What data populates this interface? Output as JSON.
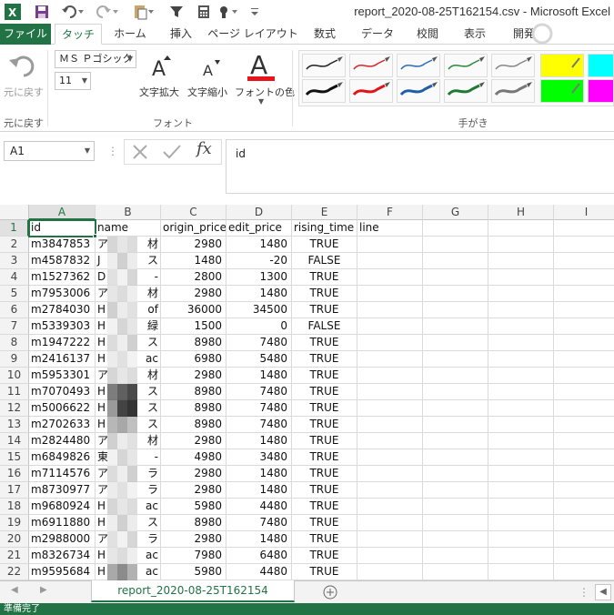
{
  "window": {
    "title": "report_2020-08-25T162154.csv - Microsoft Excel"
  },
  "ribbon": {
    "tabs": [
      {
        "label": "ファイル"
      },
      {
        "label": "タッチ"
      },
      {
        "label": "ホーム"
      },
      {
        "label": "挿入"
      },
      {
        "label": "ページ レイアウト"
      },
      {
        "label": "数式"
      },
      {
        "label": "データ"
      },
      {
        "label": "校閲"
      },
      {
        "label": "表示"
      },
      {
        "label": "開発"
      }
    ],
    "undo_label": "元に戻す",
    "undo_group_label": "元に戻す",
    "font_name": "ＭＳ Ｐゴシック",
    "font_size": "11",
    "grow_font_label": "文字拡大",
    "shrink_font_label": "文字縮小",
    "font_color_label": "フォントの色",
    "font_group_label": "フォント",
    "handwriting_group_label": "手がき",
    "accent_color": "#217346"
  },
  "formula_bar": {
    "name_box": "A1",
    "fx_label": "fx",
    "formula": "id"
  },
  "sheet": {
    "columns": [
      "A",
      "B",
      "C",
      "D",
      "E",
      "F",
      "G",
      "H",
      "I"
    ],
    "row_numbers": [
      "1",
      "2",
      "3",
      "4",
      "5",
      "6",
      "7",
      "8",
      "9",
      "10",
      "11",
      "12",
      "13",
      "14",
      "15",
      "16",
      "17",
      "18",
      "19",
      "20",
      "21",
      "22"
    ],
    "header": {
      "a": "id",
      "b": "name",
      "c": "origin_price",
      "d": "edit_price",
      "e": "rising_time",
      "f": "line"
    },
    "rows": [
      {
        "a": "m3847853",
        "b": "ア",
        "b2": "材",
        "c": "2980",
        "d": "1480",
        "e": "TRUE"
      },
      {
        "a": "m4587832",
        "b": "J",
        "b2": "ス",
        "c": "1480",
        "d": "-20",
        "e": "FALSE"
      },
      {
        "a": "m1527362",
        "b": "D",
        "b2": "-",
        "c": "2800",
        "d": "1300",
        "e": "TRUE"
      },
      {
        "a": "m7953006",
        "b": "ア",
        "b2": "材",
        "c": "2980",
        "d": "1480",
        "e": "TRUE"
      },
      {
        "a": "m2784030",
        "b": "H",
        "b2": "of",
        "c": "36000",
        "d": "34500",
        "e": "TRUE"
      },
      {
        "a": "m5339303",
        "b": "H",
        "b2": "緑",
        "c": "1500",
        "d": "0",
        "e": "FALSE"
      },
      {
        "a": "m1947222",
        "b": "H",
        "b2": "ス",
        "c": "8980",
        "d": "7480",
        "e": "TRUE"
      },
      {
        "a": "m2416137",
        "b": "H",
        "b2": "ac",
        "c": "6980",
        "d": "5480",
        "e": "TRUE"
      },
      {
        "a": "m5953301",
        "b": "ア",
        "b2": "材",
        "c": "2980",
        "d": "1480",
        "e": "TRUE"
      },
      {
        "a": "m7070493",
        "b": "H",
        "b2": "ス",
        "c": "8980",
        "d": "7480",
        "e": "TRUE"
      },
      {
        "a": "m5006622",
        "b": "H",
        "b2": "ス",
        "c": "8980",
        "d": "7480",
        "e": "TRUE"
      },
      {
        "a": "m2702633",
        "b": "H",
        "b2": "ス",
        "c": "8980",
        "d": "7480",
        "e": "TRUE"
      },
      {
        "a": "m2824480",
        "b": "ア",
        "b2": "材",
        "c": "2980",
        "d": "1480",
        "e": "TRUE"
      },
      {
        "a": "m6849826",
        "b": "東",
        "b2": "-",
        "c": "4980",
        "d": "3480",
        "e": "TRUE"
      },
      {
        "a": "m7114576",
        "b": "ア",
        "b2": "ラ",
        "c": "2980",
        "d": "1480",
        "e": "TRUE"
      },
      {
        "a": "m8730977",
        "b": "ア",
        "b2": "ラ",
        "c": "2980",
        "d": "1480",
        "e": "TRUE"
      },
      {
        "a": "m9680924",
        "b": "H",
        "b2": "ac",
        "c": "5980",
        "d": "4480",
        "e": "TRUE"
      },
      {
        "a": "m6911880",
        "b": "H",
        "b2": "ス",
        "c": "8980",
        "d": "7480",
        "e": "TRUE"
      },
      {
        "a": "m2988000",
        "b": "ア",
        "b2": "ラ",
        "c": "2980",
        "d": "1480",
        "e": "TRUE"
      },
      {
        "a": "m8326734",
        "b": "H",
        "b2": "ac",
        "c": "7980",
        "d": "6480",
        "e": "TRUE"
      },
      {
        "a": "m9595684",
        "b": "H",
        "b2": "ac",
        "c": "5980",
        "d": "4480",
        "e": "TRUE"
      }
    ],
    "tab_name": "report_2020-08-25T162154"
  },
  "status": {
    "text": "準備完了"
  }
}
